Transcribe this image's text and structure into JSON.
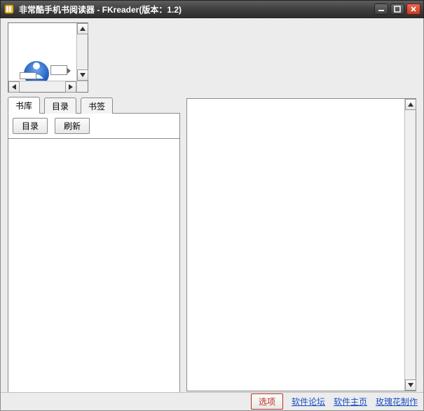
{
  "window": {
    "title": "非常酷手机书阅读器 - FKreader(版本：1.2)"
  },
  "tabs": [
    {
      "label": "书库",
      "active": true
    },
    {
      "label": "目录",
      "active": false
    },
    {
      "label": "书签",
      "active": false
    }
  ],
  "toolbar": {
    "btn_toc": "目录",
    "btn_refresh": "刷新"
  },
  "bottom": {
    "options": "选项",
    "link_forum": "软件论坛",
    "link_home": "软件主页",
    "link_rose": "玫瑰花制作"
  }
}
